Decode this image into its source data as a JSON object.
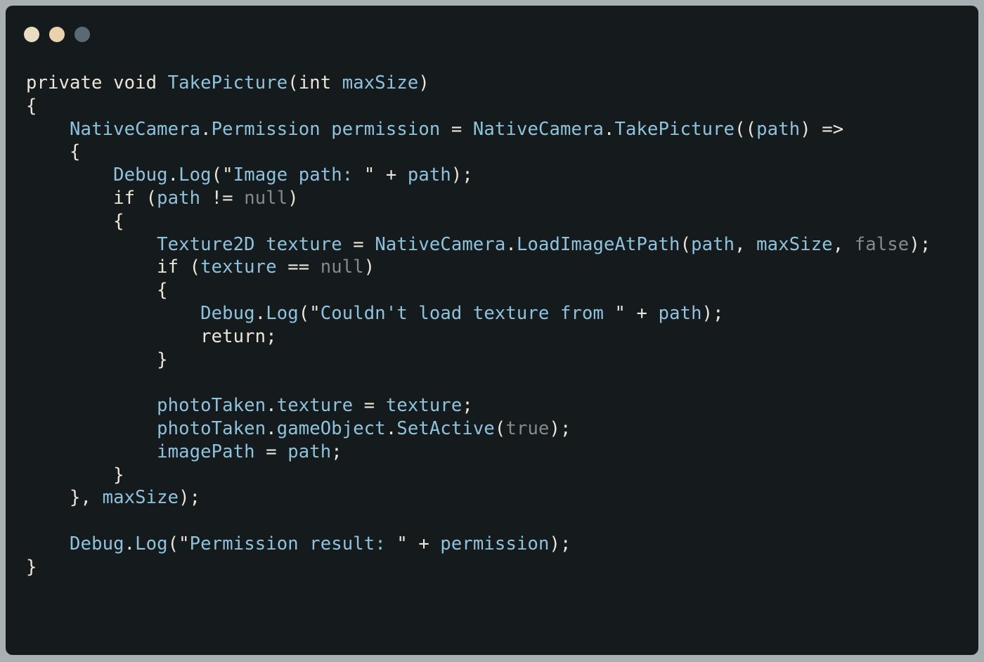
{
  "colors": {
    "background": "#151a1d",
    "frame": "#a9b0b3",
    "plain": "#ece6d8",
    "identifier": "#8ec3dd",
    "literal": "#858a8e",
    "dot_1": "#e8dcc2",
    "dot_2": "#e9d2ac",
    "dot_3": "#5a6a74"
  },
  "window_controls": [
    {
      "name": "window-dot-1",
      "color": "#e8dcc2"
    },
    {
      "name": "window-dot-2",
      "color": "#e9d2ac"
    },
    {
      "name": "window-dot-3",
      "color": "#5a6a74"
    }
  ],
  "code_lines": [
    [
      [
        "k",
        "private void "
      ],
      [
        "i",
        "TakePicture"
      ],
      [
        "k",
        "(int "
      ],
      [
        "i",
        "maxSize"
      ],
      [
        "k",
        ")"
      ]
    ],
    [
      [
        "k",
        "{"
      ]
    ],
    [
      [
        "k",
        "    "
      ],
      [
        "i",
        "NativeCamera"
      ],
      [
        "k",
        "."
      ],
      [
        "i",
        "Permission"
      ],
      [
        "k",
        " "
      ],
      [
        "i",
        "permission"
      ],
      [
        "k",
        " = "
      ],
      [
        "i",
        "NativeCamera"
      ],
      [
        "k",
        "."
      ],
      [
        "i",
        "TakePicture"
      ],
      [
        "k",
        "(("
      ],
      [
        "i",
        "path"
      ],
      [
        "k",
        ") =>"
      ]
    ],
    [
      [
        "k",
        "    {"
      ]
    ],
    [
      [
        "k",
        "        "
      ],
      [
        "i",
        "Debug"
      ],
      [
        "k",
        "."
      ],
      [
        "i",
        "Log"
      ],
      [
        "k",
        "(\""
      ],
      [
        "i",
        "Image path: "
      ],
      [
        "k",
        "\" + "
      ],
      [
        "i",
        "path"
      ],
      [
        "k",
        ");"
      ]
    ],
    [
      [
        "k",
        "        if ("
      ],
      [
        "i",
        "path"
      ],
      [
        "k",
        " != "
      ],
      [
        "l",
        "null"
      ],
      [
        "k",
        ")"
      ]
    ],
    [
      [
        "k",
        "        {"
      ]
    ],
    [
      [
        "k",
        "            "
      ],
      [
        "i",
        "Texture2D"
      ],
      [
        "k",
        " "
      ],
      [
        "i",
        "texture"
      ],
      [
        "k",
        " = "
      ],
      [
        "i",
        "NativeCamera"
      ],
      [
        "k",
        "."
      ],
      [
        "i",
        "LoadImageAtPath"
      ],
      [
        "k",
        "("
      ],
      [
        "i",
        "path"
      ],
      [
        "k",
        ", "
      ],
      [
        "i",
        "maxSize"
      ],
      [
        "k",
        ", "
      ],
      [
        "l",
        "false"
      ],
      [
        "k",
        ");"
      ]
    ],
    [
      [
        "k",
        "            if ("
      ],
      [
        "i",
        "texture"
      ],
      [
        "k",
        " == "
      ],
      [
        "l",
        "null"
      ],
      [
        "k",
        ")"
      ]
    ],
    [
      [
        "k",
        "            {"
      ]
    ],
    [
      [
        "k",
        "                "
      ],
      [
        "i",
        "Debug"
      ],
      [
        "k",
        "."
      ],
      [
        "i",
        "Log"
      ],
      [
        "k",
        "(\""
      ],
      [
        "i",
        "Couldn't load texture from "
      ],
      [
        "k",
        "\" + "
      ],
      [
        "i",
        "path"
      ],
      [
        "k",
        ");"
      ]
    ],
    [
      [
        "k",
        "                return;"
      ]
    ],
    [
      [
        "k",
        "            }"
      ]
    ],
    [
      [
        "k",
        ""
      ]
    ],
    [
      [
        "k",
        "            "
      ],
      [
        "i",
        "photoTaken"
      ],
      [
        "k",
        "."
      ],
      [
        "i",
        "texture"
      ],
      [
        "k",
        " = "
      ],
      [
        "i",
        "texture"
      ],
      [
        "k",
        ";"
      ]
    ],
    [
      [
        "k",
        "            "
      ],
      [
        "i",
        "photoTaken"
      ],
      [
        "k",
        "."
      ],
      [
        "i",
        "gameObject"
      ],
      [
        "k",
        "."
      ],
      [
        "i",
        "SetActive"
      ],
      [
        "k",
        "("
      ],
      [
        "l",
        "true"
      ],
      [
        "k",
        ");"
      ]
    ],
    [
      [
        "k",
        "            "
      ],
      [
        "i",
        "imagePath"
      ],
      [
        "k",
        " = "
      ],
      [
        "i",
        "path"
      ],
      [
        "k",
        ";"
      ]
    ],
    [
      [
        "k",
        "        }"
      ]
    ],
    [
      [
        "k",
        "    }, "
      ],
      [
        "i",
        "maxSize"
      ],
      [
        "k",
        ");"
      ]
    ],
    [
      [
        "k",
        ""
      ]
    ],
    [
      [
        "k",
        "    "
      ],
      [
        "i",
        "Debug"
      ],
      [
        "k",
        "."
      ],
      [
        "i",
        "Log"
      ],
      [
        "k",
        "(\""
      ],
      [
        "i",
        "Permission result: "
      ],
      [
        "k",
        "\" + "
      ],
      [
        "i",
        "permission"
      ],
      [
        "k",
        ");"
      ]
    ],
    [
      [
        "k",
        "}"
      ]
    ]
  ]
}
